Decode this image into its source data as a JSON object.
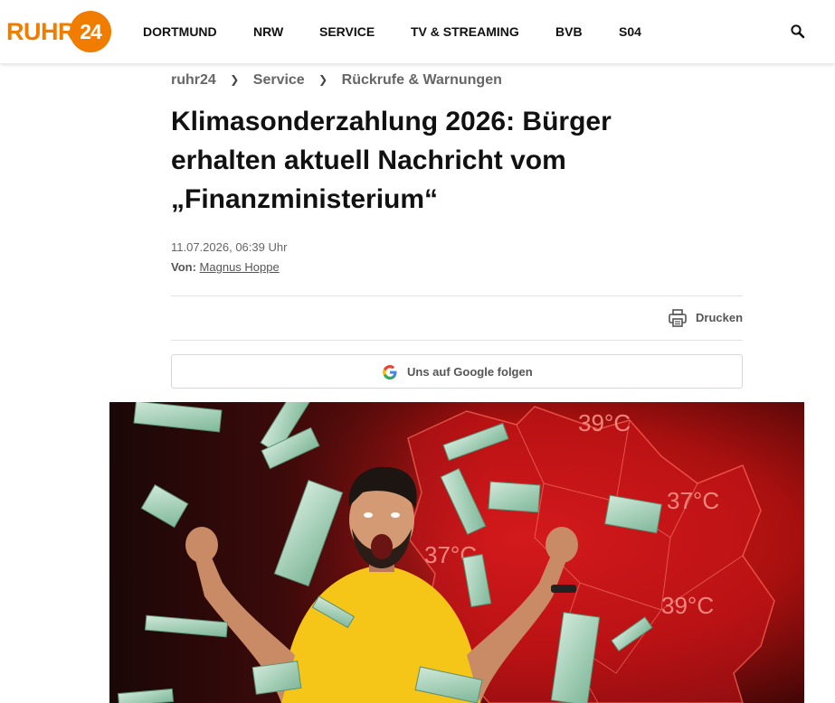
{
  "header": {
    "logo": {
      "text": "RUHR",
      "badge": "24"
    },
    "nav": [
      {
        "label": "DORTMUND"
      },
      {
        "label": "NRW"
      },
      {
        "label": "SERVICE"
      },
      {
        "label": "TV & STREAMING"
      },
      {
        "label": "BVB"
      },
      {
        "label": "S04"
      }
    ],
    "search_icon": "search-icon"
  },
  "breadcrumb": [
    "ruhr24",
    "Service",
    "Rückrufe & Warnungen"
  ],
  "breadcrumb_separator": "❯",
  "article": {
    "headline": "Klimasonderzahlung 2026: Bürger erhalten aktuell Nachricht vom „Finanzministerium“",
    "date": "11.07.2026, 06:39 Uhr",
    "author_prefix": "Von:",
    "author": "Magnus Hoppe"
  },
  "actions": {
    "print_label": "Drucken",
    "print_icon": "printer-icon",
    "google_follow_label": "Uns auf Google folgen",
    "google_icon": "google-g-icon"
  },
  "hero_image": {
    "temperature_labels": [
      "39°C",
      "37°C",
      "37°C",
      "39°C"
    ]
  },
  "colors": {
    "brand_orange": "#f07d00",
    "text_dark": "#111111",
    "text_muted": "#666666",
    "divider": "#e2e2e2",
    "map_red": "#c8141a"
  }
}
